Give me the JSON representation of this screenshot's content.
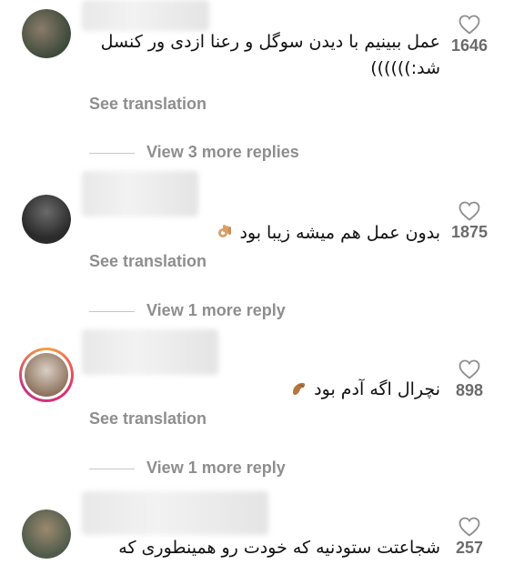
{
  "comments": [
    {
      "text": "عمل ببینیم با دیدن سوگل و رعنا ازدی ور کنسل شد:))))))",
      "see_translation": "See translation",
      "view_replies": "View 3 more replies",
      "likes": "1646",
      "avatar_colors": [
        "#3d4a3a",
        "#8a7b6a"
      ]
    },
    {
      "text": "بدون عمل هم میشه زیبا بود",
      "emoji": "ok-hand-emoji",
      "see_translation": "See translation",
      "view_replies": "View 1 more reply",
      "likes": "1875",
      "avatar_colors": [
        "#2b2b2b",
        "#6a6a6a"
      ]
    },
    {
      "text": "نچرال اگه آدم بود",
      "emoji": "pinching-hand-emoji",
      "see_translation": "See translation",
      "view_replies": "View 1 more reply",
      "likes": "898",
      "avatar_colors": [
        "#d9cfc4",
        "#8b6f5a"
      ],
      "has_story_ring": true
    },
    {
      "text": "شجاعتت ستودنیه که خودت رو همینطوری که",
      "likes": "257",
      "avatar_colors": [
        "#4f5a4a",
        "#9b8a70"
      ]
    }
  ],
  "colors": {
    "secondary_text": "#8e8e8e",
    "primary_text": "#111111",
    "divider": "#c7c7c7",
    "story_ring": "#e1306c"
  },
  "icons": {
    "like": "heart-outline-icon"
  }
}
